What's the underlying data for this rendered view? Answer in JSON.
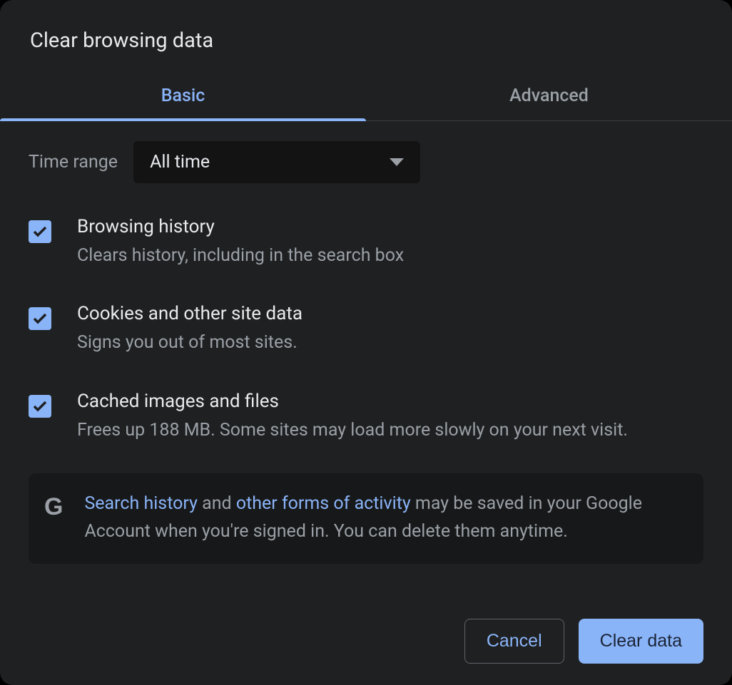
{
  "title": "Clear browsing data",
  "tabs": {
    "basic": "Basic",
    "advanced": "Advanced"
  },
  "timeRange": {
    "label": "Time range",
    "selected": "All time"
  },
  "options": [
    {
      "title": "Browsing history",
      "desc": "Clears history, including in the search box",
      "checked": true
    },
    {
      "title": "Cookies and other site data",
      "desc": "Signs you out of most sites.",
      "checked": true
    },
    {
      "title": "Cached images and files",
      "desc": "Frees up 188 MB. Some sites may load more slowly on your next visit.",
      "checked": true
    }
  ],
  "info": {
    "link1": "Search history",
    "mid1": " and ",
    "link2": "other forms of activity",
    "rest": " may be saved in your Google Account when you're signed in. You can delete them anytime."
  },
  "buttons": {
    "cancel": "Cancel",
    "clear": "Clear data"
  }
}
